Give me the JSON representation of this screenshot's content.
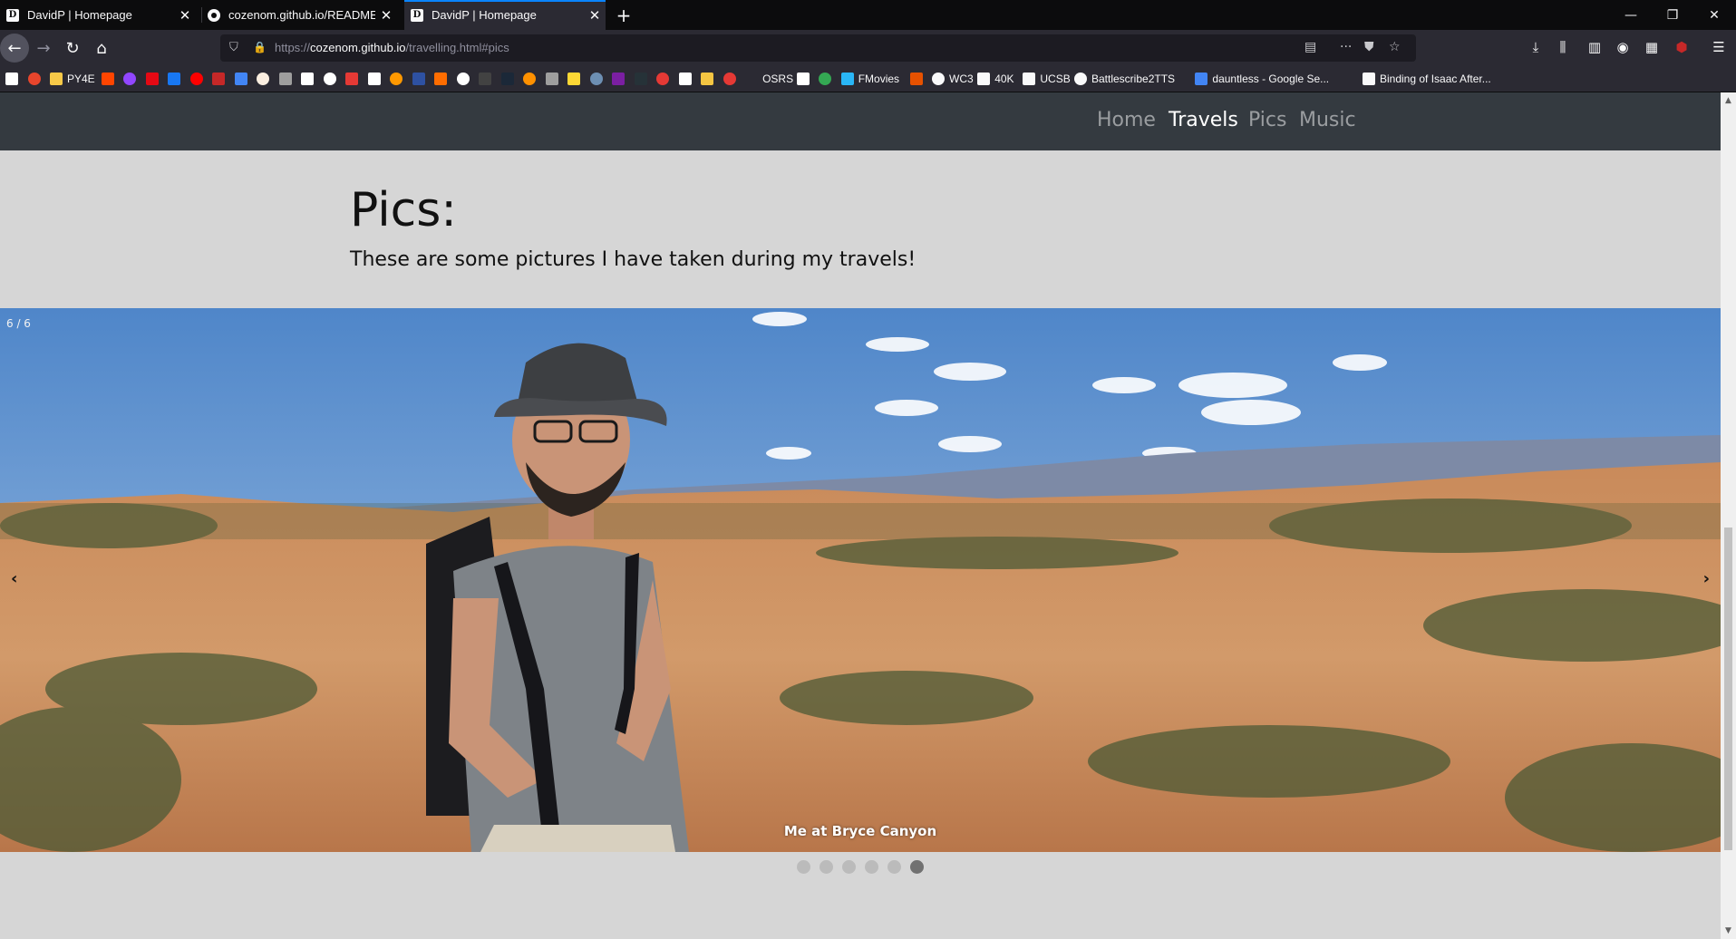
{
  "browser": {
    "tabs": [
      {
        "title": "DavidP | Homepage",
        "favicon": "D",
        "active": false
      },
      {
        "title": "cozenom.github.io/README.m",
        "favicon": "github-icon",
        "active": false
      },
      {
        "title": "DavidP | Homepage",
        "favicon": "D",
        "active": true
      }
    ],
    "url_prefix": "https://",
    "url_host": "cozenom.github.io",
    "url_path": "/travelling.html#pics",
    "bookmarks": [
      {
        "label": "",
        "color": "#ffffff"
      },
      {
        "label": "",
        "color": "#e8452c"
      },
      {
        "label": "PY4E",
        "color": "#f7c948"
      },
      {
        "label": "",
        "color": "#ff4500"
      },
      {
        "label": "",
        "color": "#9146ff"
      },
      {
        "label": "",
        "color": "#e50914"
      },
      {
        "label": "",
        "color": "#1877f2"
      },
      {
        "label": "",
        "color": "#ff0000"
      },
      {
        "label": "",
        "color": "#c62828"
      },
      {
        "label": "",
        "color": "#4285f4"
      },
      {
        "label": "",
        "color": "#fbeee0"
      },
      {
        "label": "",
        "color": "#9e9e9e"
      },
      {
        "label": "",
        "color": "#ffffff"
      },
      {
        "label": "",
        "color": "#ffffff"
      },
      {
        "label": "",
        "color": "#e53935"
      },
      {
        "label": "",
        "color": "#ffffff"
      },
      {
        "label": "",
        "color": "#ff9800"
      },
      {
        "label": "",
        "color": "#2e51a2"
      },
      {
        "label": "",
        "color": "#ff6d00"
      },
      {
        "label": "",
        "color": "#ffffff"
      },
      {
        "label": "",
        "color": "#424242"
      },
      {
        "label": "",
        "color": "#1b2838"
      },
      {
        "label": "",
        "color": "#ff9100"
      },
      {
        "label": "",
        "color": "#9e9e9e"
      },
      {
        "label": "",
        "color": "#fdd835"
      },
      {
        "label": "",
        "color": "#6d8fb3"
      },
      {
        "label": "",
        "color": "#7b1fa2"
      },
      {
        "label": "",
        "color": "#263238"
      },
      {
        "label": "",
        "color": "#e53935"
      },
      {
        "label": "",
        "color": "#ffffff"
      },
      {
        "label": "",
        "color": "#f4c542"
      },
      {
        "label": "",
        "color": "#e53935"
      },
      {
        "label": "OSRS",
        "color": "#2b2a33"
      },
      {
        "label": "",
        "color": "#ffffff"
      },
      {
        "label": "",
        "color": "#34a853"
      },
      {
        "label": "FMovies",
        "color": "#29b6f6"
      },
      {
        "label": "",
        "color": "#e65100"
      },
      {
        "label": "WC3",
        "color": "#f9f9fa"
      },
      {
        "label": "40K",
        "color": "#f9f9fa"
      },
      {
        "label": "UCSB",
        "color": "#f9f9fa"
      },
      {
        "label": "Battlescribe2TTS",
        "color": "#f9f9fa"
      },
      {
        "label": "dauntless - Google Se...",
        "color": "#4285f4"
      },
      {
        "label": "Binding of Isaac After...",
        "color": "#f9f9fa"
      }
    ]
  },
  "site": {
    "nav": [
      "Home",
      "Travels",
      "Pics",
      "Music"
    ],
    "active_nav": "Travels",
    "heading": "Pics:",
    "subtitle": "These are some pictures I have taken during my travels!"
  },
  "slideshow": {
    "counter": "6 / 6",
    "caption": "Me at Bryce Canyon",
    "prev_label": "‹",
    "next_label": "›",
    "total": 6,
    "current": 6
  }
}
